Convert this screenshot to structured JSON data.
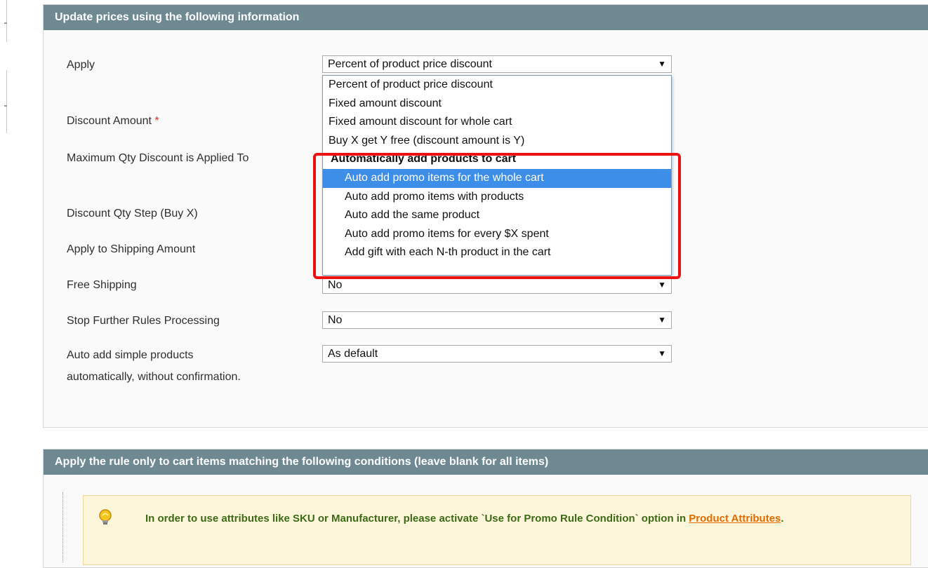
{
  "section1": {
    "title": "Update prices using the following information"
  },
  "form": {
    "apply_label": "Apply",
    "apply_value": "Percent of product price discount",
    "discount_amount_label": "Discount Amount",
    "required_mark": "*",
    "max_qty_label": "Maximum Qty Discount is Applied To",
    "discount_step_label": "Discount Qty Step (Buy X)",
    "apply_shipping_label": "Apply to Shipping Amount",
    "free_shipping_label": "Free Shipping",
    "free_shipping_value": "No",
    "stop_rules_label": "Stop Further Rules Processing",
    "stop_rules_value": "No",
    "auto_add_label": "Auto add simple products automatically, without confirmation.",
    "auto_add_value": "As default"
  },
  "dropdown": {
    "options": [
      "Percent of product price discount",
      "Fixed amount discount",
      "Fixed amount discount for whole cart",
      "Buy X get Y free (discount amount is Y)"
    ],
    "group_label": "Automatically add products to cart",
    "group_options": [
      "Auto add promo items for the whole cart",
      "Auto add promo items with products",
      "Auto add the same product",
      "Auto add promo items for every $X spent",
      "Add gift with each N-th product in the cart"
    ],
    "selected_option": "Auto add promo items for the whole cart"
  },
  "section2": {
    "title": "Apply the rule only to cart items matching the following conditions (leave blank for all items)",
    "notice_text": "In order to use attributes like SKU or Manufacturer, please activate `Use for Promo Rule Condition` option in ",
    "notice_link": "Product Attributes",
    "notice_end": "."
  },
  "icons": {
    "arrow": "dropdown-arrow-icon",
    "notice": "lightbulb-icon"
  },
  "colors": {
    "header_bg": "#6f8992",
    "selected_bg": "#3d8ee8",
    "highlight": "#ee1111",
    "notice_bg": "#fdf6da",
    "notice_text": "#3c6a16",
    "link": "#e06b00"
  }
}
